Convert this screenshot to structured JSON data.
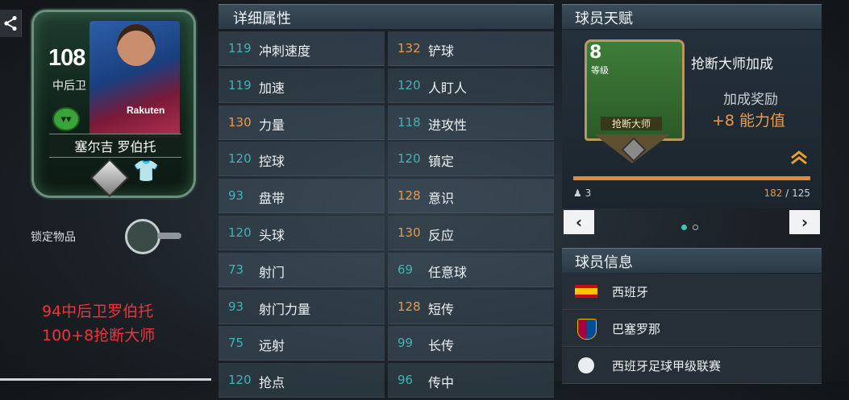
{
  "card": {
    "rating": "108",
    "position": "中后卫",
    "name": "塞尔吉 罗伯托",
    "sponsor": "Rakuten"
  },
  "lock": {
    "label": "锁定物品"
  },
  "overlay": {
    "line1": "94中后卫罗伯托",
    "line2": "100+8抢断大师"
  },
  "attributes": {
    "title": "详细属性",
    "left": [
      {
        "value": "119",
        "name": "冲刺速度",
        "color": "teal"
      },
      {
        "value": "119",
        "name": "加速",
        "color": "teal"
      },
      {
        "value": "130",
        "name": "力量",
        "color": "orange"
      },
      {
        "value": "120",
        "name": "控球",
        "color": "teal"
      },
      {
        "value": "93",
        "name": "盘带",
        "color": "teal"
      },
      {
        "value": "120",
        "name": "头球",
        "color": "teal"
      },
      {
        "value": "73",
        "name": "射门",
        "color": "teal"
      },
      {
        "value": "93",
        "name": "射门力量",
        "color": "teal"
      },
      {
        "value": "75",
        "name": "远射",
        "color": "teal"
      },
      {
        "value": "120",
        "name": "抢点",
        "color": "teal"
      }
    ],
    "right": [
      {
        "value": "132",
        "name": "铲球",
        "color": "orange"
      },
      {
        "value": "120",
        "name": "人盯人",
        "color": "teal"
      },
      {
        "value": "118",
        "name": "进攻性",
        "color": "teal"
      },
      {
        "value": "120",
        "name": "镇定",
        "color": "teal"
      },
      {
        "value": "128",
        "name": "意识",
        "color": "orange"
      },
      {
        "value": "130",
        "name": "反应",
        "color": "orange"
      },
      {
        "value": "69",
        "name": "任意球",
        "color": "teal"
      },
      {
        "value": "128",
        "name": "短传",
        "color": "orange"
      },
      {
        "value": "99",
        "name": "长传",
        "color": "teal"
      },
      {
        "value": "96",
        "name": "传中",
        "color": "teal"
      }
    ]
  },
  "trait": {
    "title": "球员天赋",
    "badge_level": "8",
    "badge_level_label": "等级",
    "badge_name": "抢断大师",
    "name": "抢断大师加成",
    "bonus_label": "加成奖励",
    "bonus_value": "+8 能力值",
    "count": "3",
    "progress_current": "182",
    "progress_total": "/ 125",
    "progress_fraction": 1.0,
    "prev": "‹",
    "next": "›"
  },
  "info": {
    "title": "球员信息",
    "nation": "西班牙",
    "club": "巴塞罗那",
    "league": "西班牙足球甲级联赛"
  },
  "colors": {
    "teal": "#3fb4b8",
    "orange": "#e89a4c",
    "red": "#f1333a"
  }
}
